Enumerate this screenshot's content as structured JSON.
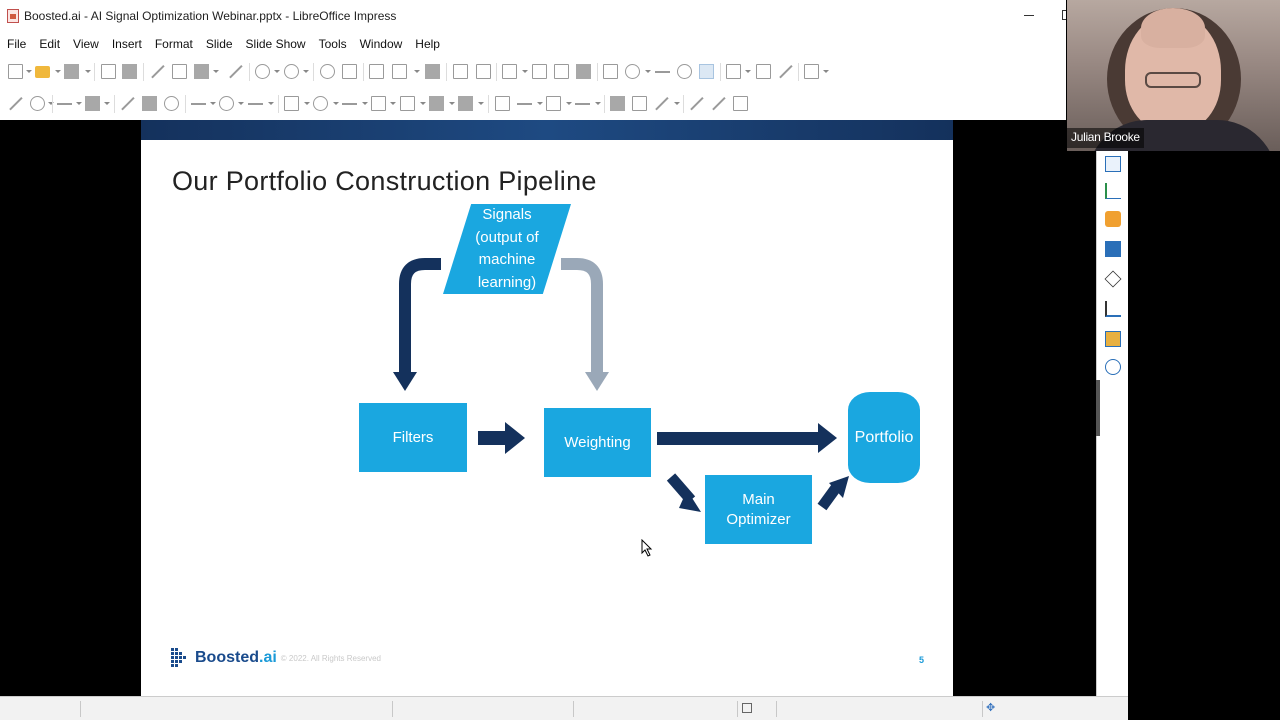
{
  "window": {
    "title": "Boosted.ai - AI Signal Optimization Webinar.pptx - LibreOffice Impress"
  },
  "menu": {
    "items": [
      {
        "label": "File"
      },
      {
        "label": "Edit"
      },
      {
        "label": "View"
      },
      {
        "label": "Insert"
      },
      {
        "label": "Format"
      },
      {
        "label": "Slide"
      },
      {
        "label": "Slide Show"
      },
      {
        "label": "Tools"
      },
      {
        "label": "Window"
      },
      {
        "label": "Help"
      }
    ]
  },
  "webcam": {
    "name": "Julian Brooke"
  },
  "slide": {
    "title": "Our Portfolio Construction Pipeline",
    "signals_lines": [
      "Signals",
      "(output of",
      "machine",
      "learning)"
    ],
    "filters": "Filters",
    "weighting": "Weighting",
    "main_optimizer_lines": [
      "Main",
      "Optimizer"
    ],
    "portfolio": "Portfolio",
    "logo": {
      "part1": "Boosted",
      "part2": ".ai"
    },
    "copyright": "© 2022. All Rights Reserved",
    "number": "5",
    "colors": {
      "box": "#1aa7e0",
      "arrow_dark": "#14315c",
      "arrow_grey": "#9aa8b8"
    }
  },
  "sidebar": {
    "icons": [
      "properties-icon",
      "slide-transition-icon",
      "animation-icon",
      "master-slides-icon",
      "shapes-icon",
      "styles-icon",
      "gallery-icon",
      "navigator-icon"
    ]
  }
}
